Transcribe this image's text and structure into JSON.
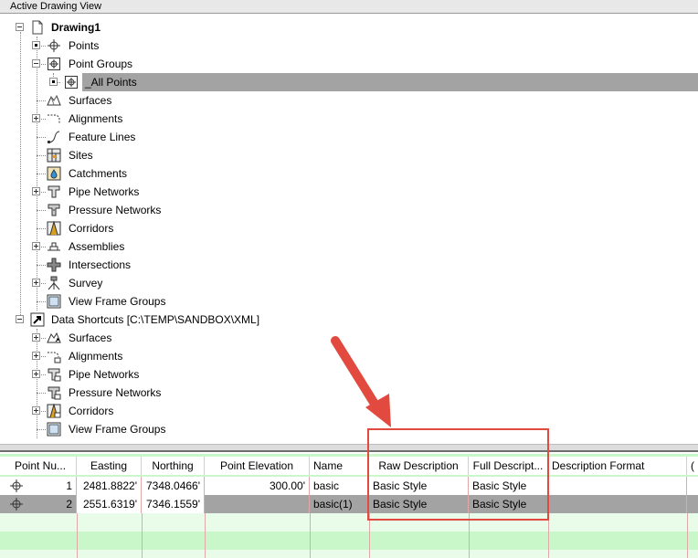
{
  "panel_title": "Active Drawing View",
  "tree": {
    "root": "Drawing1",
    "items": [
      {
        "label": "Points"
      },
      {
        "label": "Point Groups"
      },
      {
        "label": "_All Points"
      },
      {
        "label": "Surfaces"
      },
      {
        "label": "Alignments"
      },
      {
        "label": "Feature Lines"
      },
      {
        "label": "Sites"
      },
      {
        "label": "Catchments"
      },
      {
        "label": "Pipe Networks"
      },
      {
        "label": "Pressure Networks"
      },
      {
        "label": "Corridors"
      },
      {
        "label": "Assemblies"
      },
      {
        "label": "Intersections"
      },
      {
        "label": "Survey"
      },
      {
        "label": "View Frame Groups"
      }
    ],
    "shortcuts_root": "Data Shortcuts [C:\\TEMP\\SANDBOX\\XML]",
    "shortcut_items": [
      {
        "label": "Surfaces"
      },
      {
        "label": "Alignments"
      },
      {
        "label": "Pipe Networks"
      },
      {
        "label": "Pressure Networks"
      },
      {
        "label": "Corridors"
      },
      {
        "label": "View Frame Groups"
      }
    ]
  },
  "table": {
    "headers": [
      "Point Nu...",
      "Easting",
      "Northing",
      "Point Elevation",
      "Name",
      "Raw Description",
      "Full Descript...",
      "Description Format",
      "("
    ],
    "rows": [
      [
        "1",
        "2481.8822'",
        "7348.0466'",
        "300.00'",
        "basic",
        "Basic Style",
        "Basic Style",
        ""
      ],
      [
        "2",
        "2551.6319'",
        "7346.1559'",
        "",
        "basic(1)",
        "Basic Style",
        "Basic Style",
        ""
      ]
    ]
  },
  "colors": {
    "selection": "#a3a3a3",
    "grid_empty": "#c9f7c9",
    "annotation": "#e24a3f"
  }
}
